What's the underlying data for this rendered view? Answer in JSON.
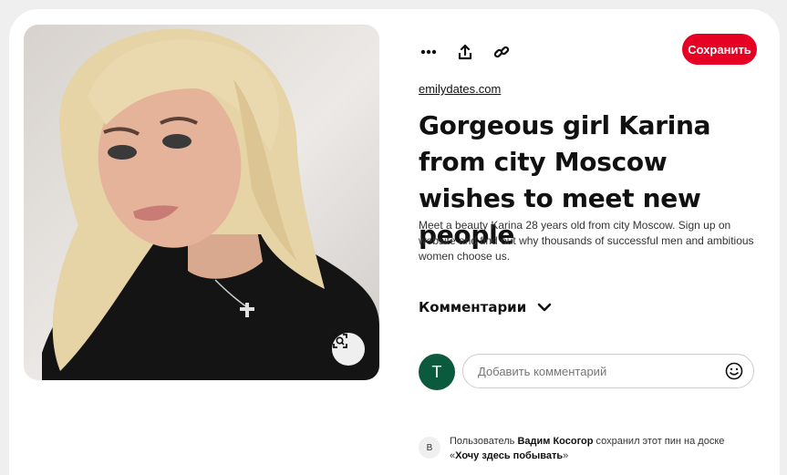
{
  "pin": {
    "source": "emilydates.com",
    "title": "Gorgeous girl Karina from city Moscow wishes to meet new people",
    "description": "Meet a beauty Karina 28 years old from city Moscow. Sign up on website and find out why thousands of successful men and ambitious women choose us.",
    "save_label": "Сохранить"
  },
  "toolbar": {
    "icons": [
      "more-icon",
      "share-icon",
      "link-icon"
    ]
  },
  "comments": {
    "header": "Комментарии",
    "avatar_initial": "T",
    "placeholder": "Добавить комментарий"
  },
  "activity": {
    "avatar_initial": "В",
    "prefix": "Пользователь ",
    "user": "Вадим Косогор",
    "middle": " сохранил этот пин на доске «",
    "board": "Хочу здесь побывать",
    "suffix": "»"
  },
  "colors": {
    "save_button": "#e60023",
    "avatar_bg": "#0c5a3e"
  }
}
